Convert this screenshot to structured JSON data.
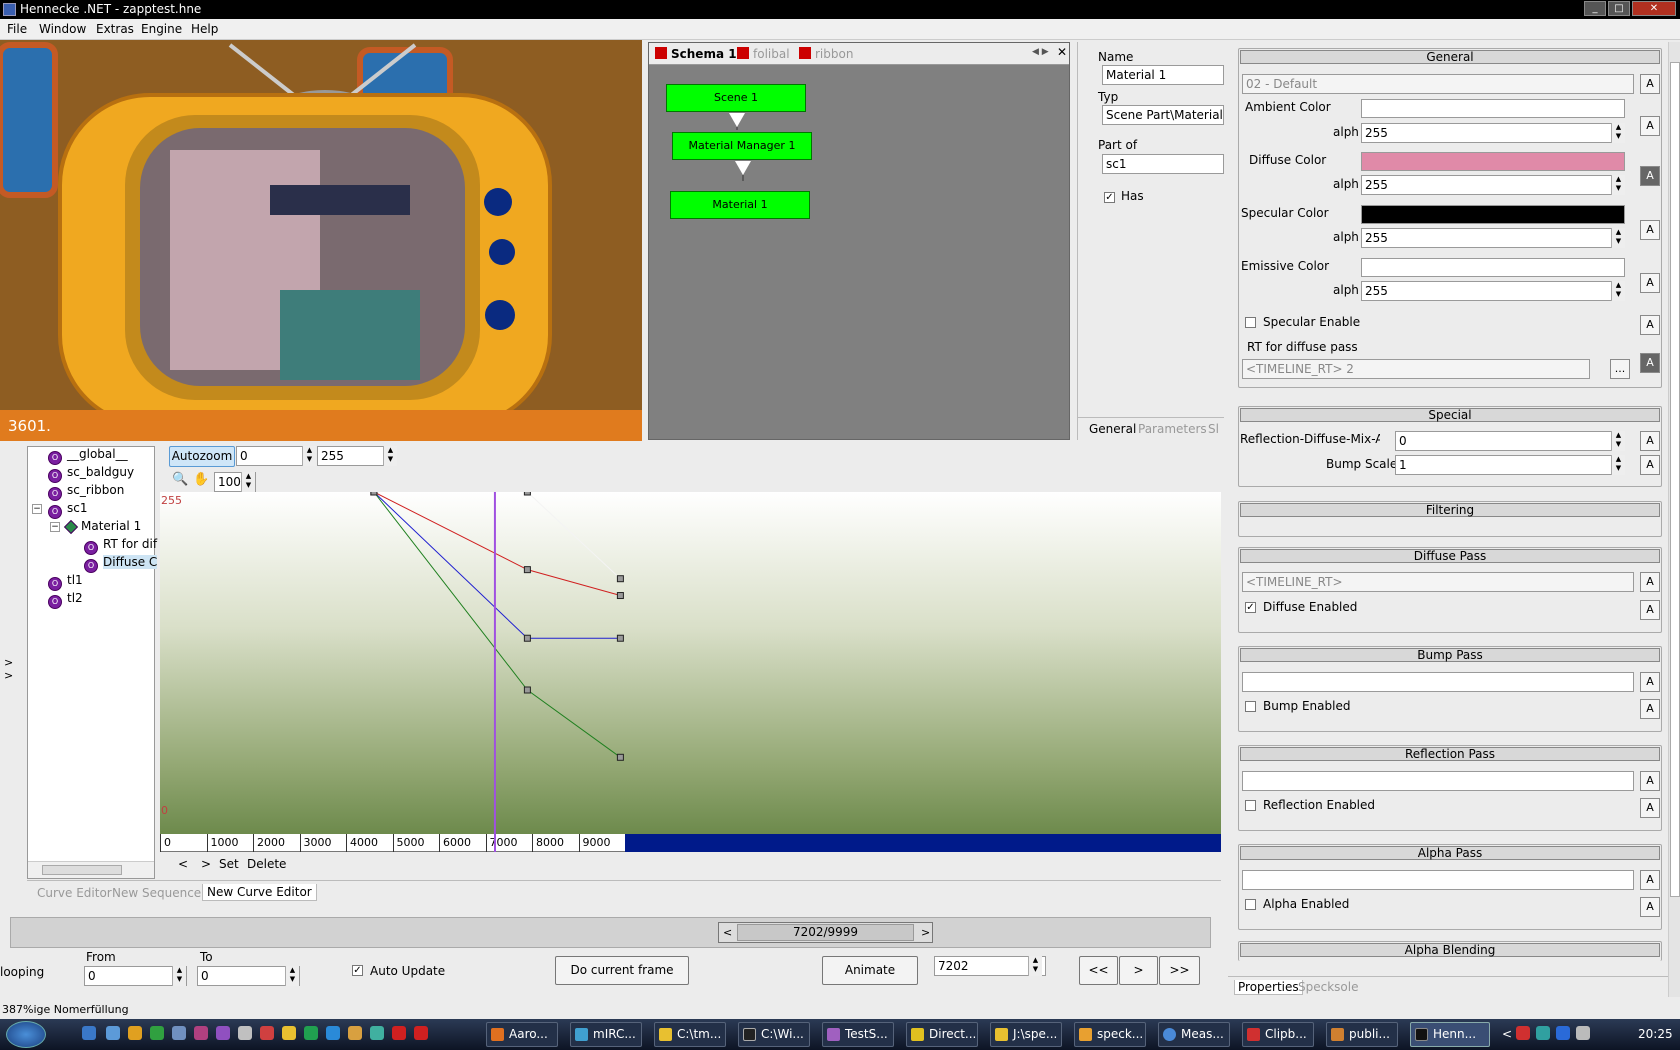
{
  "window": {
    "title": "Hennecke .NET - zapptest.hne"
  },
  "menu": [
    "File",
    "Window",
    "Extras",
    "Engine",
    "Help"
  ],
  "viewport": {
    "frame_text": "3601."
  },
  "schema": {
    "tabs": [
      "Schema 1",
      "folibal",
      "ribbon"
    ],
    "nodes": [
      "Scene 1",
      "Material Manager 1",
      "Material 1"
    ]
  },
  "object_info": {
    "name_label": "Name",
    "name_value": "Material 1",
    "type_label": "Typ",
    "type_value": "Scene Part\\Material (M",
    "part_of_label": "Part of",
    "part_of_value": "sc1",
    "has_label": "Has",
    "tabs": [
      "General",
      "Parameters",
      "Sl"
    ]
  },
  "props": {
    "general": {
      "header": "General",
      "preset": "02 - Default",
      "ambient_label": "Ambient Color",
      "alph_label": "alph",
      "ambient_alpha": "255",
      "diffuse_label": "Diffuse Color",
      "diffuse_color": "#e08aa8",
      "diffuse_alpha": "255",
      "specular_label": "Specular Color",
      "specular_color": "#000000",
      "specular_alpha": "255",
      "emissive_label": "Emissive Color",
      "emissive_alpha": "255",
      "specular_enable": "Specular Enable",
      "rt_label": "RT for diffuse pass",
      "rt_value": "<TIMELINE_RT> 2",
      "browse": "..."
    },
    "special": {
      "header": "Special",
      "reflection_label": "Reflection-Diffuse-Mix-Amou",
      "reflection_value": "0",
      "bump_scale_label": "Bump Scale",
      "bump_scale_value": "1"
    },
    "filtering": {
      "header": "Filtering"
    },
    "diffuse_pass": {
      "header": "Diffuse Pass",
      "value": "<TIMELINE_RT>",
      "enabled_label": "Diffuse Enabled"
    },
    "bump_pass": {
      "header": "Bump Pass",
      "enabled_label": "Bump Enabled"
    },
    "reflection_pass": {
      "header": "Reflection Pass",
      "enabled_label": "Reflection Enabled"
    },
    "alpha_pass": {
      "header": "Alpha Pass",
      "enabled_label": "Alpha Enabled"
    },
    "alpha_blending": {
      "header": "Alpha Blending"
    },
    "a_label": "A",
    "bottom_tabs": [
      "Properties",
      "Specksole"
    ]
  },
  "tree": {
    "items": [
      "__global__",
      "sc_baldguy",
      "sc_ribbon",
      "sc1",
      "Material 1",
      "RT for dif",
      "Diffuse C",
      "tl1",
      "tl2"
    ]
  },
  "curve_editor": {
    "autozoom": "Autozoom",
    "min": "0",
    "max": "255",
    "zoom": "100",
    "y_top": "255",
    "y_bottom": "0",
    "ticks": [
      "0",
      "1000",
      "2000",
      "3000",
      "4000",
      "5000",
      "6000",
      "7000",
      "8000",
      "9000"
    ],
    "nav_prev": "<",
    "nav_next": ">",
    "set": "Set",
    "delete": "Delete",
    "tabs": [
      "Curve Editor",
      "New Sequencer",
      "New Curve Editor"
    ]
  },
  "chart_data": {
    "type": "line",
    "xlim": [
      0,
      9999
    ],
    "ylim": [
      0,
      255
    ],
    "cursor_x": 7202,
    "series": [
      {
        "color": "#d02020",
        "x": [
          4600,
          7900,
          9900
        ],
        "y": [
          255,
          195,
          175
        ]
      },
      {
        "color": "#2020d0",
        "x": [
          4600,
          7900,
          9900
        ],
        "y": [
          255,
          142,
          142
        ]
      },
      {
        "color": "#208020",
        "x": [
          4600,
          7900,
          9900
        ],
        "y": [
          255,
          102,
          50
        ]
      },
      {
        "color": "#f4f4f4",
        "x": [
          7900,
          9900
        ],
        "y": [
          255,
          188
        ]
      }
    ]
  },
  "timeline": {
    "position": "7202/9999",
    "left_arrow": "<",
    "right_arrow": ">",
    "looping_label": "looping",
    "from_label": "From",
    "from_value": "0",
    "to_label": "To",
    "to_value": "0",
    "auto_update": "Auto Update",
    "do_frame": "Do current frame",
    "animate": "Animate",
    "frame": "7202",
    "rew": "<<",
    "play": ">",
    "fwd": ">>"
  },
  "status": {
    "text": "387%ige Nomerfüllung"
  },
  "taskbar": {
    "items": [
      "Aaro...",
      "mIRC...",
      "C:\\tm...",
      "C:\\Wi...",
      "TestS...",
      "Direct...",
      "J:\\spe...",
      "speck...",
      "Meas...",
      "Clipb...",
      "publi...",
      "Henn..."
    ],
    "clock": "20:25",
    "chevron": "<"
  }
}
